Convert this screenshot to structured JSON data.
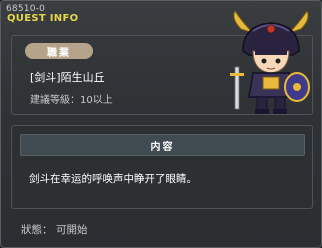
{
  "window": {
    "quest_id": "68510-0",
    "title": "QUEST INFO"
  },
  "quest": {
    "job_label": "職業",
    "name": "[剑斗]陌生山丘",
    "recommended_level": "建議等級：10以上"
  },
  "content": {
    "header": "内容",
    "text": "剑斗在幸运的呼唤声中睁开了眼睛。"
  },
  "status": {
    "label": "狀態：",
    "value": "可開始"
  },
  "portrait": {
    "icon": "warrior-character-portrait",
    "colors": {
      "helmet": "#2a2340",
      "horns": "#e8b93a",
      "armor": "#3b3357",
      "skin": "#f6d7b8"
    }
  }
}
